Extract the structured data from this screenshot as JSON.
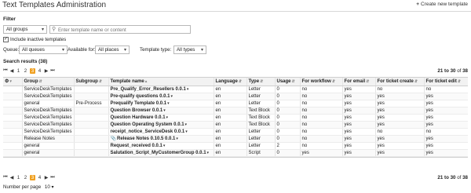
{
  "header": {
    "title": "Text Templates Administration",
    "create_label": "Create new template"
  },
  "filter": {
    "label": "Filter",
    "group_value": "All groups",
    "search_placeholder": "Enter template name or content",
    "include_inactive_label": "Include inactive templates",
    "include_inactive_checked": true,
    "queue_label": "Queue:",
    "queue_value": "All queues",
    "available_label": "Available for:",
    "available_value": "All places",
    "type_label": "Template type:",
    "type_value": "All types"
  },
  "results": {
    "label": "Search results (38)",
    "pages": [
      "1",
      "2",
      "3",
      "4"
    ],
    "current_page": "3",
    "range_from_to": "21 to 30",
    "range_of": "of",
    "range_total": "38"
  },
  "table": {
    "settings_icon": "gear-icon",
    "columns": [
      "",
      "Group",
      "Subgroup",
      "Template name",
      "Language",
      "Type",
      "Usage",
      "For workflow",
      "For email",
      "For ticket create",
      "For ticket edit"
    ],
    "rows": [
      {
        "group": "ServiceDeskTemplates",
        "subgroup": "",
        "name": "Pre_Qualify_Error_Resellers 0.0.1",
        "attach": false,
        "language": "en",
        "type": "Letter",
        "usage": "0",
        "workflow": "no",
        "email": "yes",
        "create": "no",
        "edit": "no"
      },
      {
        "group": "ServiceDeskTemplates",
        "subgroup": "",
        "name": "Pre-qualify questions 0.0.1",
        "attach": false,
        "language": "en",
        "type": "Letter",
        "usage": "0",
        "workflow": "no",
        "email": "yes",
        "create": "yes",
        "edit": "yes"
      },
      {
        "group": "general",
        "subgroup": "Pre-Process",
        "name": "Prequalify Template 0.0.1",
        "attach": false,
        "language": "en",
        "type": "Letter",
        "usage": "0",
        "workflow": "no",
        "email": "yes",
        "create": "yes",
        "edit": "yes"
      },
      {
        "group": "ServiceDeskTemplates",
        "subgroup": "",
        "name": "Question Browser 0.0.1",
        "attach": false,
        "language": "en",
        "type": "Text Block",
        "usage": "0",
        "workflow": "no",
        "email": "yes",
        "create": "yes",
        "edit": "yes"
      },
      {
        "group": "ServiceDeskTemplates",
        "subgroup": "",
        "name": "Question Hardware 0.0.1",
        "attach": false,
        "language": "en",
        "type": "Text Block",
        "usage": "0",
        "workflow": "no",
        "email": "yes",
        "create": "yes",
        "edit": "yes"
      },
      {
        "group": "ServiceDeskTemplates",
        "subgroup": "",
        "name": "Question Operating System 0.0.1",
        "attach": false,
        "language": "en",
        "type": "Text Block",
        "usage": "0",
        "workflow": "no",
        "email": "yes",
        "create": "yes",
        "edit": "yes"
      },
      {
        "group": "ServiceDeskTemplates",
        "subgroup": "",
        "name": "receipt_notice_ServiceDesk 0.0.1",
        "attach": false,
        "language": "en",
        "type": "Letter",
        "usage": "0",
        "workflow": "no",
        "email": "yes",
        "create": "no",
        "edit": "no"
      },
      {
        "group": "Release Notes",
        "subgroup": "",
        "name": "Release Notes 0.10.5 0.0.1",
        "attach": true,
        "language": "en",
        "type": "Letter",
        "usage": "0",
        "workflow": "no",
        "email": "yes",
        "create": "yes",
        "edit": "yes"
      },
      {
        "group": "general",
        "subgroup": "",
        "name": "Request_received 0.0.1",
        "attach": false,
        "language": "en",
        "type": "Letter",
        "usage": "2",
        "workflow": "no",
        "email": "yes",
        "create": "yes",
        "edit": "yes"
      },
      {
        "group": "general",
        "subgroup": "",
        "name": "Salutation_Script_MyCustomerGroup 0.0.1",
        "attach": false,
        "language": "en",
        "type": "Script",
        "usage": "0",
        "workflow": "yes",
        "email": "yes",
        "create": "yes",
        "edit": "yes"
      }
    ]
  },
  "footer": {
    "per_page_label": "Number per page",
    "per_page_value": "10"
  }
}
